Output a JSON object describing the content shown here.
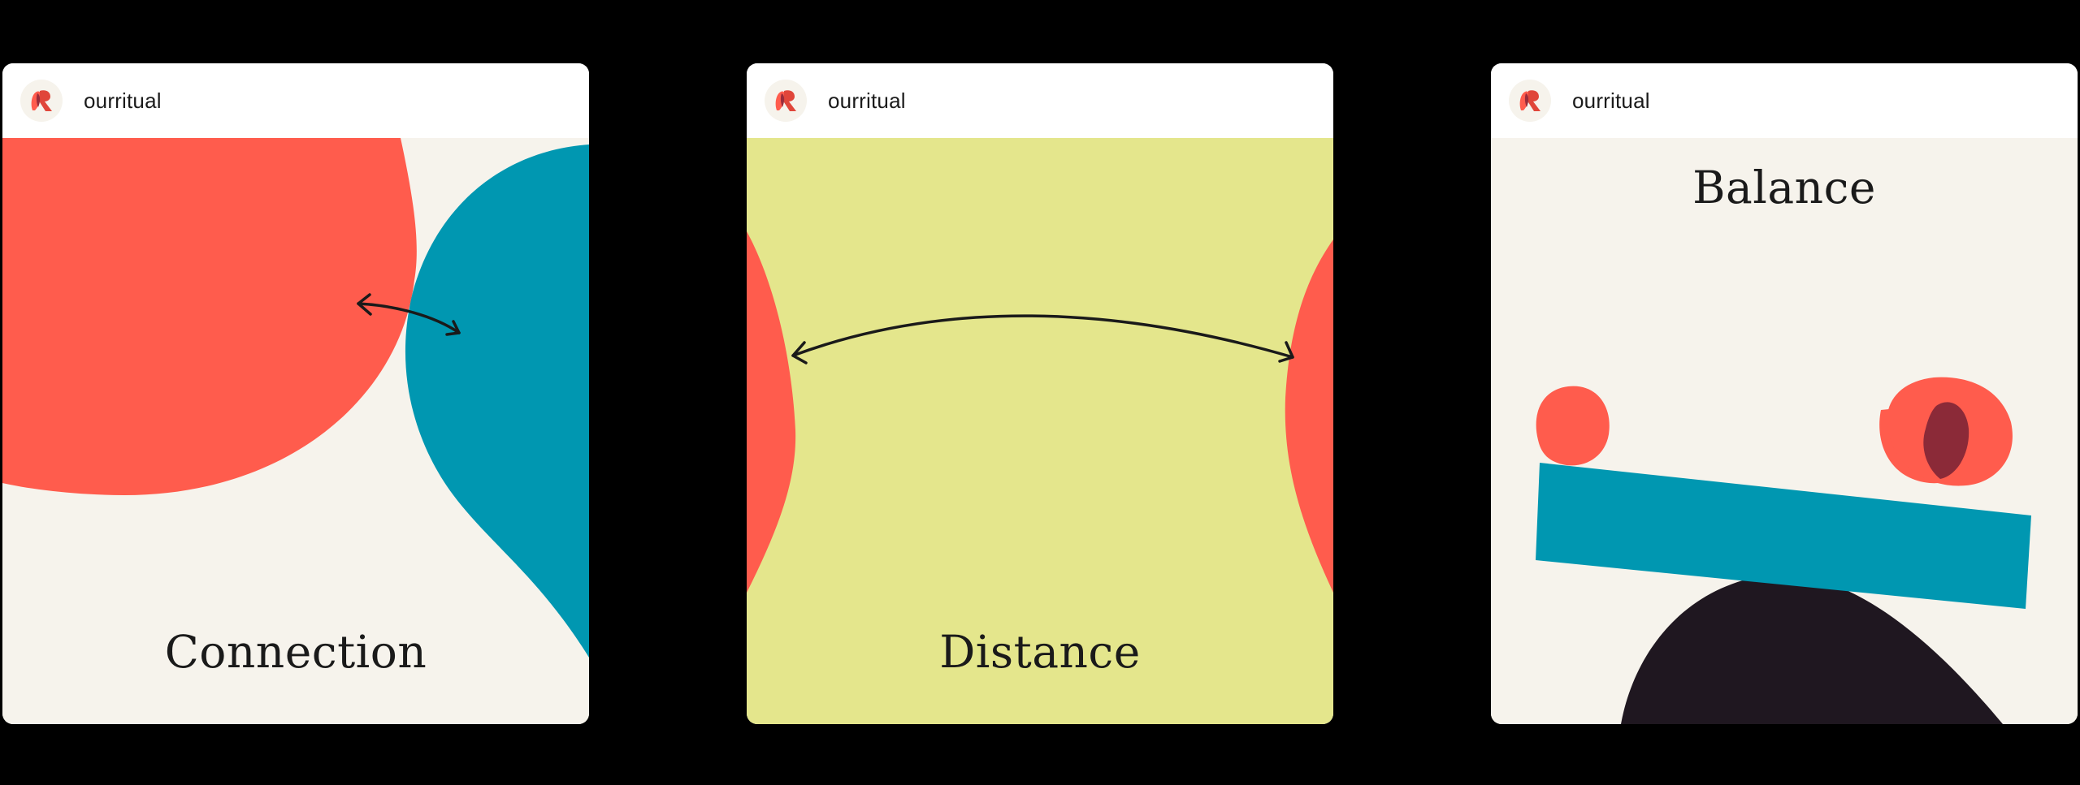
{
  "cards": [
    {
      "account": "ourritual",
      "title": "Connection",
      "colors": {
        "background": "#F6F3EC",
        "shape_left": "#FF5C4D",
        "shape_right": "#0097B1",
        "arrow": "#1A1A1A"
      }
    },
    {
      "account": "ourritual",
      "title": "Distance",
      "colors": {
        "background": "#E4E68C",
        "shape_left": "#FF5C4D",
        "shape_right": "#FF5C4D",
        "arrow": "#1A1A1A"
      }
    },
    {
      "account": "ourritual",
      "title": "Balance",
      "colors": {
        "background": "#F6F3EC",
        "beam": "#0097B1",
        "fulcrum": "#1F1720",
        "stones": "#FF5C4D",
        "overlap": "#8B2A38"
      }
    }
  ],
  "icons": {
    "logo": "ourritual-logo-icon",
    "arrow": "double-arrow-icon"
  }
}
